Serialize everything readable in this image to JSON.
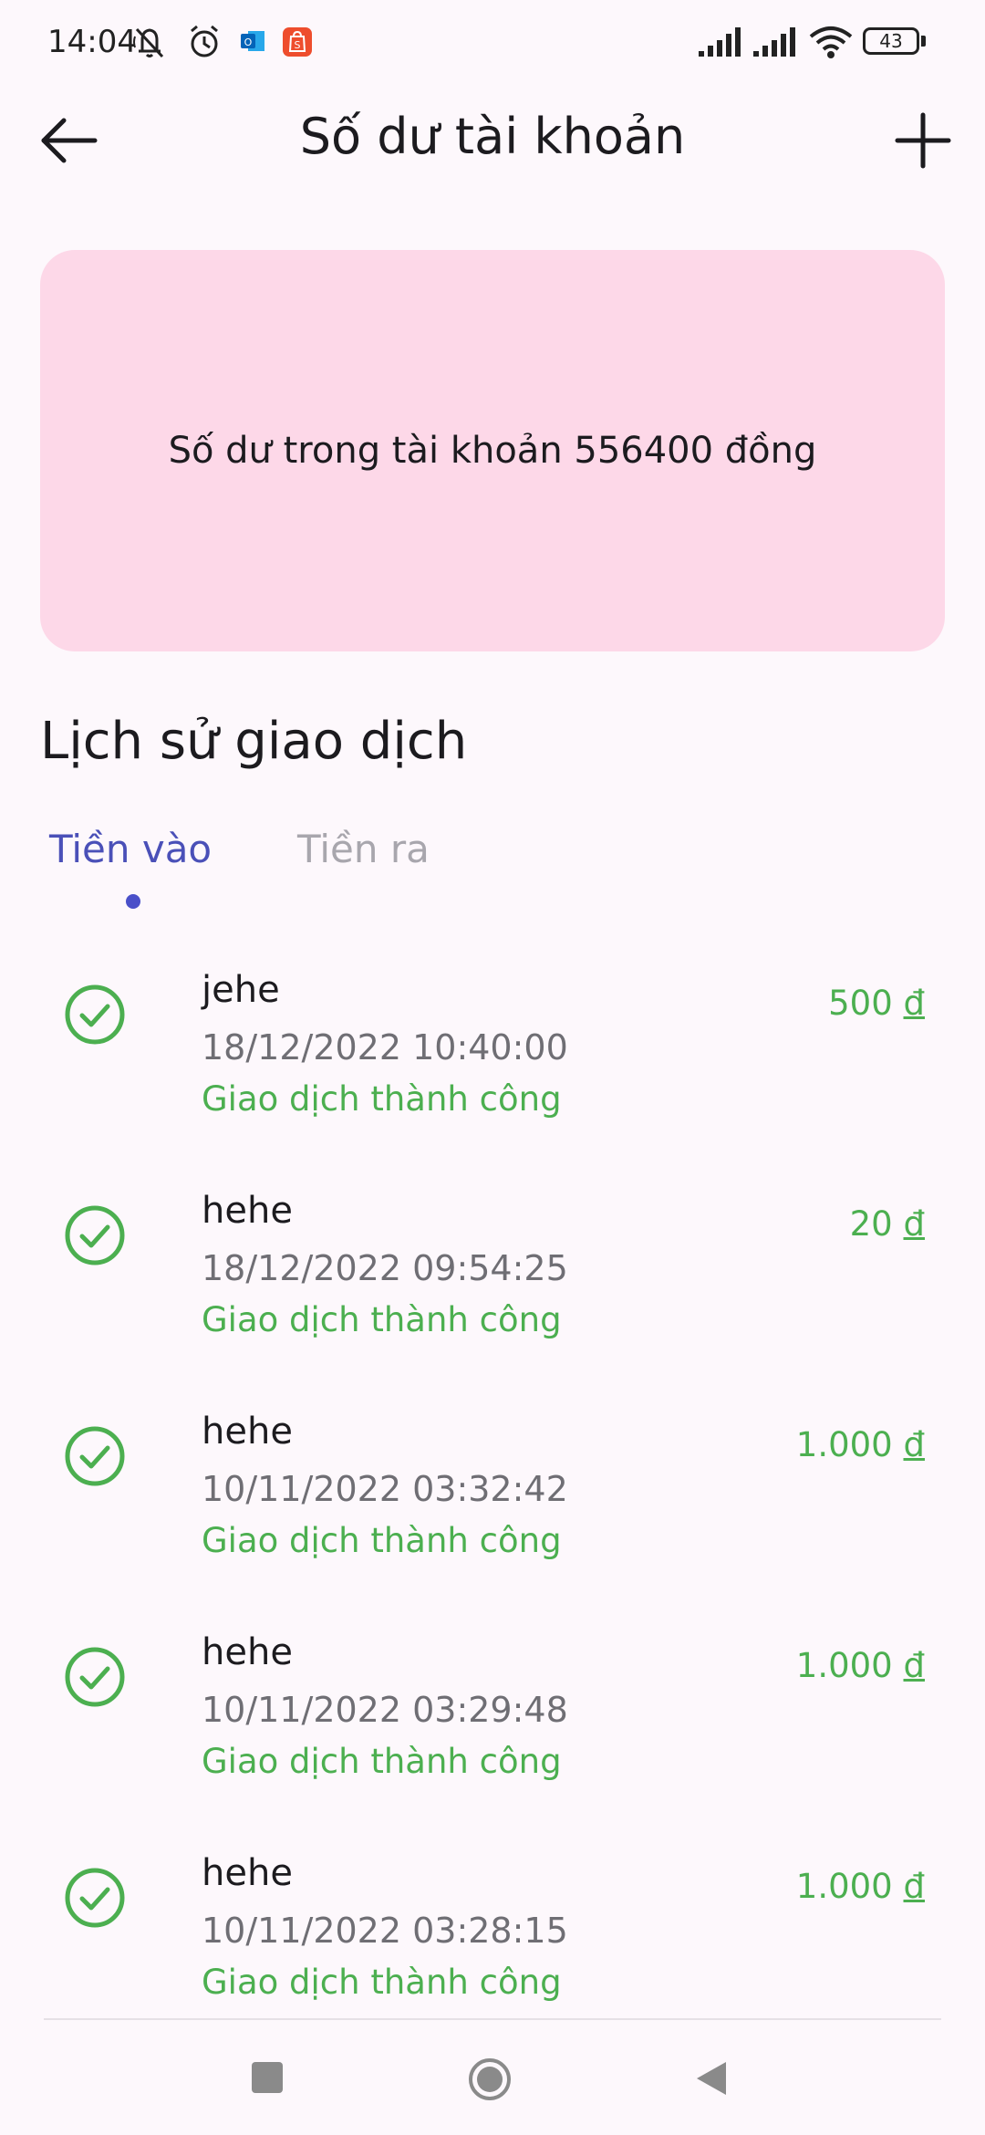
{
  "status_bar": {
    "time": "14:04",
    "battery_level": "43",
    "icons": [
      "bell-muted-icon",
      "alarm-icon",
      "outlook-icon",
      "shopee-icon",
      "signal-icon",
      "signal-icon",
      "wifi-icon",
      "battery-icon"
    ]
  },
  "app_bar": {
    "title": "Số dư tài khoản",
    "back_icon": "arrow-left-icon",
    "add_icon": "plus-icon"
  },
  "balance_card": {
    "text": "Số dư trong tài khoản 556400 đồng",
    "color": "#fdd8e8"
  },
  "history": {
    "title": "Lịch sử giao dịch",
    "tabs": [
      {
        "label": "Tiền vào",
        "active": true
      },
      {
        "label": "Tiền ra",
        "active": false
      }
    ],
    "transactions": [
      {
        "name": "jehe",
        "time": "18/12/2022 10:40:00",
        "status": "Giao dịch thành công",
        "amount": "500",
        "currency": "đ"
      },
      {
        "name": "hehe",
        "time": "18/12/2022 09:54:25",
        "status": "Giao dịch thành công",
        "amount": "20",
        "currency": "đ"
      },
      {
        "name": "hehe",
        "time": "10/11/2022 03:32:42",
        "status": "Giao dịch thành công",
        "amount": "1.000",
        "currency": "đ"
      },
      {
        "name": "hehe",
        "time": "10/11/2022 03:29:48",
        "status": "Giao dịch thành công",
        "amount": "1.000",
        "currency": "đ"
      },
      {
        "name": "hehe",
        "time": "10/11/2022 03:28:15",
        "status": "Giao dịch thành công",
        "amount": "1.000",
        "currency": "đ"
      }
    ]
  },
  "colors": {
    "accent": "#4a50b8",
    "success": "#4caf50",
    "inactive_tab": "#a8a6ad"
  },
  "nav_bar": {
    "icons": [
      "recents-icon",
      "home-icon",
      "back-triangle-icon"
    ]
  }
}
